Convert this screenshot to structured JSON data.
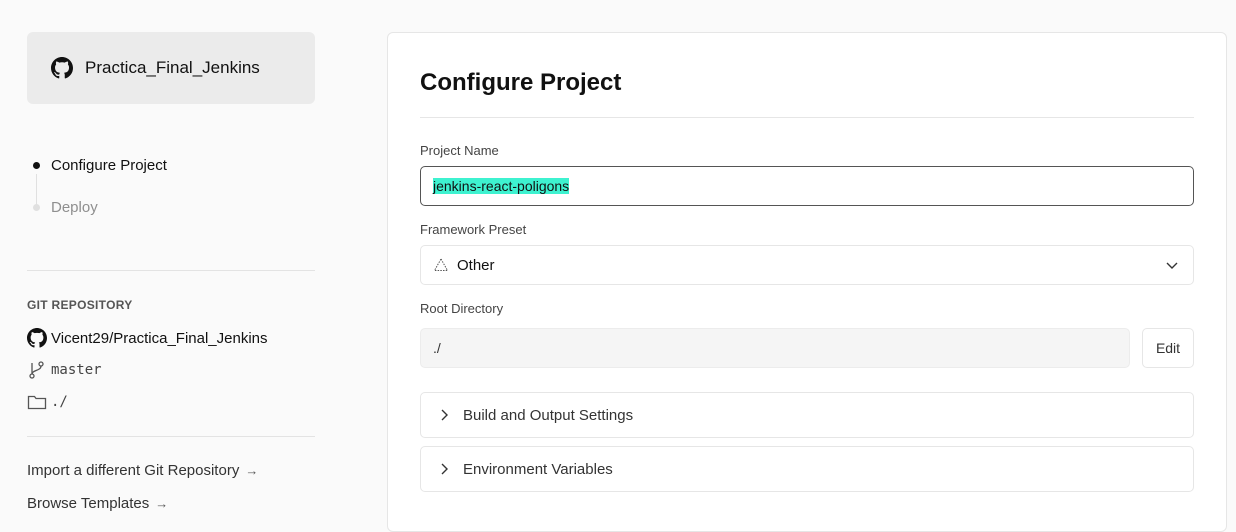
{
  "repo_card": {
    "title": "Practica_Final_Jenkins",
    "icon": "github-icon"
  },
  "steps": [
    {
      "label": "Configure Project",
      "state": "active"
    },
    {
      "label": "Deploy",
      "state": "inactive"
    }
  ],
  "git": {
    "heading": "GIT REPOSITORY",
    "repository": "Vicent29/Practica_Final_Jenkins",
    "branch": "master",
    "directory": "./"
  },
  "links": {
    "import": "Import a different Git Repository",
    "templates": "Browse Templates",
    "arrow": "→"
  },
  "panel": {
    "title": "Configure Project",
    "project_name_label": "Project Name",
    "project_name_value": "jenkins-react-poligons",
    "framework_label": "Framework Preset",
    "framework_value": "Other",
    "root_label": "Root Directory",
    "root_value": "./",
    "edit_label": "Edit",
    "build_settings": "Build and Output Settings",
    "env_vars": "Environment Variables"
  },
  "colors": {
    "background": "#fafafa",
    "selection_highlight": "#3ef2d0",
    "card": "#ebebeb"
  }
}
